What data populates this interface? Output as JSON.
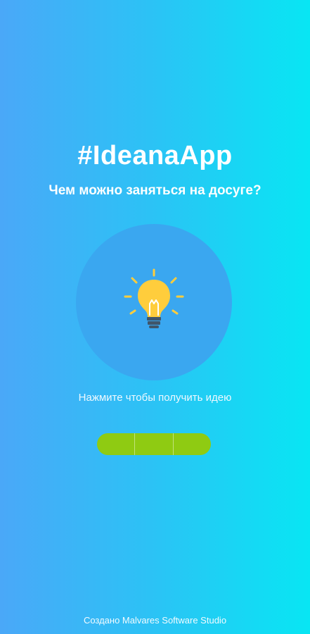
{
  "app": {
    "title": "#IdeanaApp",
    "subtitle": "Чем можно заняться на досуге?"
  },
  "main": {
    "hint": "Нажмите чтобы получить идею",
    "idea_button_icon": "lightbulb-icon",
    "progress": {
      "segments": 3,
      "color": "#8fcb12"
    }
  },
  "footer": {
    "credits": "Создано Malvares Software Studio"
  },
  "colors": {
    "gradient_left": "#4aa8f8",
    "gradient_right": "#08e6f3",
    "circle": "#3aa7f0",
    "bulb": "#ffcd3c"
  }
}
